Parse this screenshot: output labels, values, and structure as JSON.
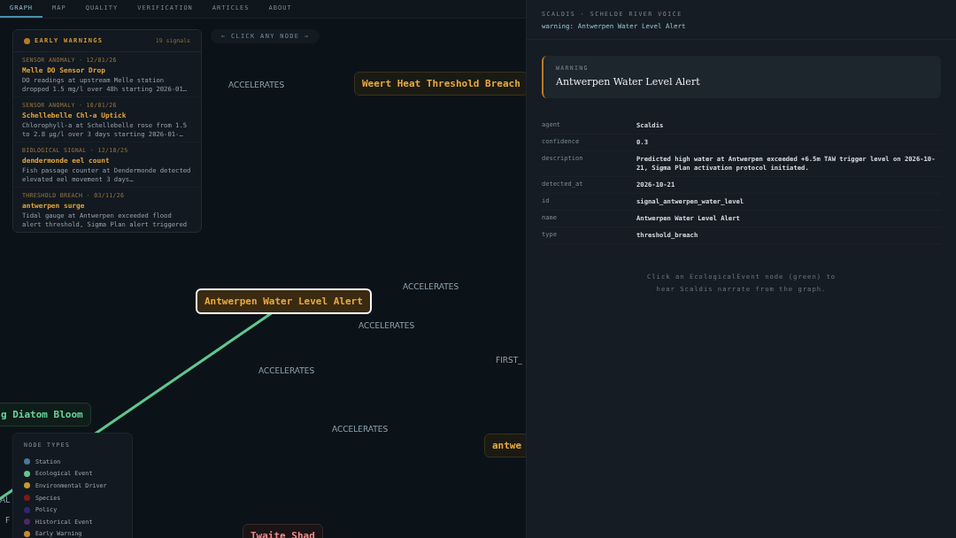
{
  "tabs": [
    {
      "label": "GRAPH",
      "selected": true
    },
    {
      "label": "MAP",
      "selected": false
    },
    {
      "label": "QUALITY",
      "selected": false
    },
    {
      "label": "VERIFICATION",
      "selected": false
    },
    {
      "label": "ARTICLES",
      "selected": false
    },
    {
      "label": "ABOUT",
      "selected": false
    }
  ],
  "hint": "← CLICK ANY NODE →",
  "early_warnings": {
    "title": "EARLY WARNINGS",
    "count": "19 signals",
    "items": [
      {
        "meta": "SENSOR ANOMALY · 12/01/26",
        "title": "Melle DO Sensor Drop",
        "text": "DO readings at upstream Melle station dropped 1.5 mg/l over 48h starting 2026-01…"
      },
      {
        "meta": "SENSOR ANOMALY · 10/01/26",
        "title": "Schellebelle Chl-a Uptick",
        "text": "Chlorophyll-a at Schellebelle rose from 1.5 to 2.8 µg/l over 3 days starting 2026-01-…"
      },
      {
        "meta": "BIOLOGICAL SIGNAL · 12/10/25",
        "title": "dendermonde eel count",
        "text": "Fish passage counter at Dendermonde detected elevated eel movement 3 days…"
      },
      {
        "meta": "THRESHOLD BREACH · 03/11/26",
        "title": "antwerpen surge",
        "text": "Tidal gauge at Antwerpen exceeded flood alert threshold, Sigma Plan alert triggered"
      }
    ]
  },
  "graph": {
    "nodes": [
      {
        "label": "Weert Heat Threshold Breach",
        "kind": "warning",
        "selected": false
      },
      {
        "label": "Antwerpen Water Level Alert",
        "kind": "warning",
        "selected": true
      },
      {
        "label": "g Diatom Bloom",
        "kind": "ecological",
        "selected": false
      },
      {
        "label": "antwe",
        "kind": "warning",
        "selected": false
      },
      {
        "label": "Twaite Shad",
        "kind": "species",
        "selected": false
      }
    ],
    "edge_labels": [
      "ACCELERATES",
      "ACCELERATES",
      "ACCELERATES",
      "ACCELERATES",
      "ACCELERATES",
      "FIRST_",
      "AL",
      "F"
    ]
  },
  "legend": {
    "title": "NODE TYPES",
    "items": [
      {
        "label": "Station",
        "color": "#4a7a94"
      },
      {
        "label": "Ecological Event",
        "color": "#5fc78f"
      },
      {
        "label": "Environmental Driver",
        "color": "#c8982e"
      },
      {
        "label": "Species",
        "color": "#7a1a1a"
      },
      {
        "label": "Policy",
        "color": "#2e2870"
      },
      {
        "label": "Historical Event",
        "color": "#4a2a6a"
      },
      {
        "label": "Early Warning",
        "color": "#c8892e"
      }
    ]
  },
  "panel": {
    "eyebrow": "SCALDIS · SCHELDE RIVER VOICE",
    "subtitle": "warning: Antwerpen Water Level Alert",
    "card": {
      "kind_label": "WARNING",
      "title": "Antwerpen Water Level Alert"
    },
    "properties": [
      {
        "key": "agent",
        "value": "Scaldis"
      },
      {
        "key": "confidence",
        "value": "0.3"
      },
      {
        "key": "description",
        "value": "Predicted high water at Antwerpen exceeded +6.5m TAW trigger level on 2026-10-21, Sigma Plan activation protocol initiated."
      },
      {
        "key": "detected_at",
        "value": "2026-10-21"
      },
      {
        "key": "id",
        "value": "signal_antwerpen_water_level"
      },
      {
        "key": "name",
        "value": "Antwerpen Water Level Alert"
      },
      {
        "key": "type",
        "value": "threshold_breach"
      }
    ],
    "note": "Click an EcologicalEvent node (green) to hear Scaldis narrate from the graph."
  }
}
